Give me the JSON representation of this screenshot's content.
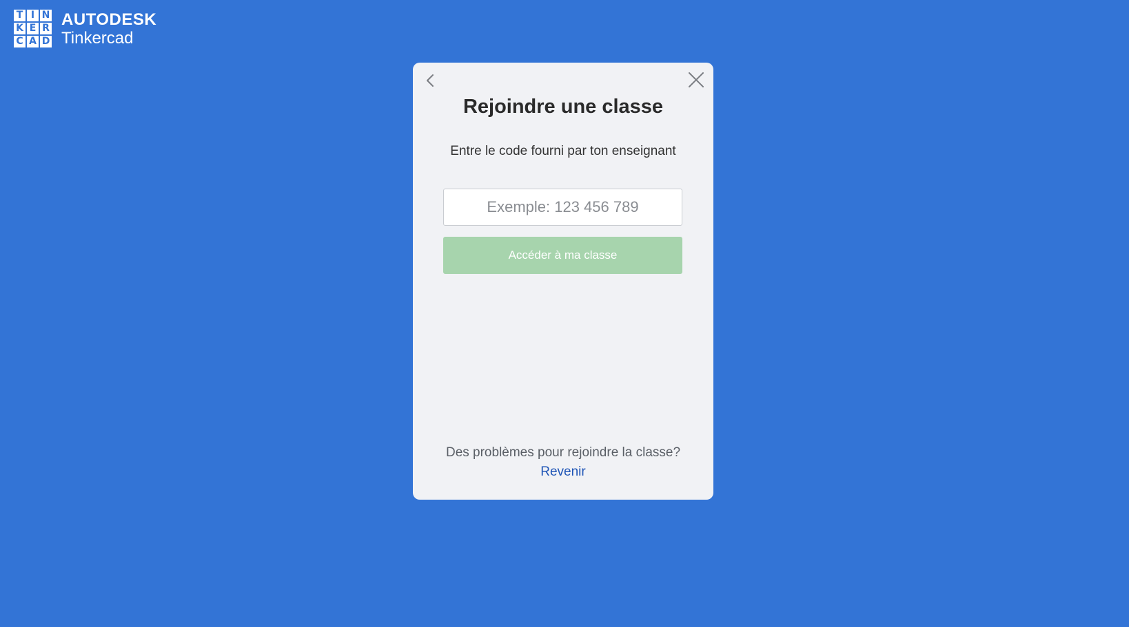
{
  "logo": {
    "grid": [
      "T",
      "I",
      "N",
      "K",
      "E",
      "R",
      "C",
      "A",
      "D"
    ],
    "brand": "AUTODESK",
    "product": "Tinkercad"
  },
  "modal": {
    "title": "Rejoindre une classe",
    "subtitle": "Entre le code fourni par ton enseignant",
    "input": {
      "value": "",
      "placeholder": "Exemple: 123 456 789"
    },
    "submit_label": "Accéder à ma classe",
    "help_text": "Des problèmes pour rejoindre la classe?",
    "help_link": "Revenir",
    "icons": {
      "back": "chevron-left-icon",
      "close": "close-icon"
    }
  },
  "colors": {
    "background": "#3374d6",
    "modal_background": "#f1f2f5",
    "button_disabled": "#a7d4ad",
    "link": "#1f55b6"
  }
}
